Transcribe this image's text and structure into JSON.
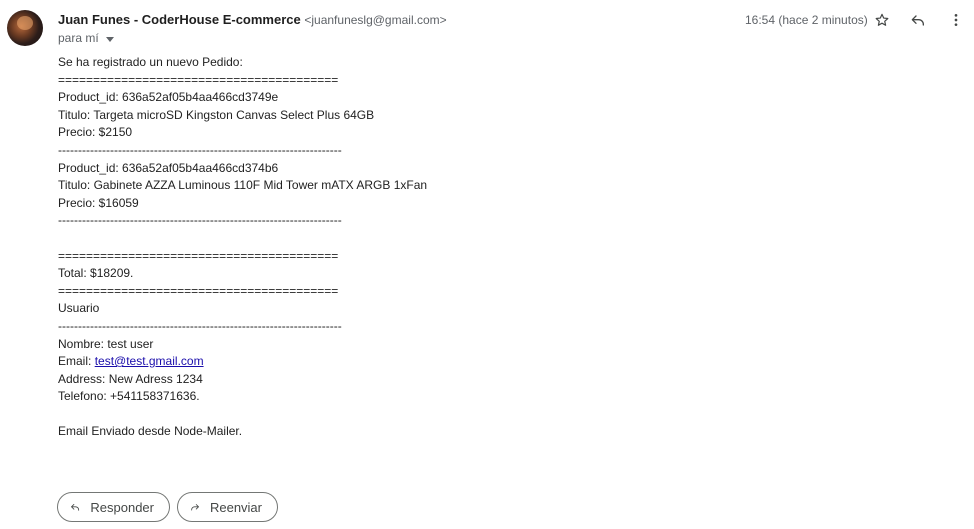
{
  "sender": {
    "name": "Juan Funes - CoderHouse E-commerce",
    "email": "<juanfuneslg@gmail.com>"
  },
  "recipient": "para mí",
  "timestamp": "16:54 (hace 2 minutos)",
  "icons": {
    "star": "star-icon",
    "reply": "reply-icon",
    "more": "more-vert-icon",
    "forward": "forward-icon"
  },
  "body": {
    "intro": "Se ha registrado un nuevo Pedido:",
    "double_rule": "========================================",
    "single_rule": "-----------------------------------------------------------------------",
    "products": [
      {
        "id_line": "Product_id: 636a52af05b4aa466cd3749e",
        "title_line": "Titulo: Targeta microSD Kingston Canvas Select Plus 64GB",
        "price_line": "Precio: $2150"
      },
      {
        "id_line": "Product_id: 636a52af05b4aa466cd374b6",
        "title_line": "Titulo: Gabinete AZZA Luminous 110F Mid Tower mATX ARGB 1xFan",
        "price_line": "Precio: $16059"
      }
    ],
    "total": "Total: $18209.",
    "user_heading": "Usuario",
    "name_line": "Nombre: test user",
    "email_label": "Email: ",
    "email_link": "test@test.gmail.com",
    "address_line": "Address: New Adress 1234",
    "phone_line": "Telefono: +541158371636.",
    "footer": "Email Enviado desde Node-Mailer."
  },
  "actions": {
    "reply": "Responder",
    "forward": "Reenviar"
  }
}
